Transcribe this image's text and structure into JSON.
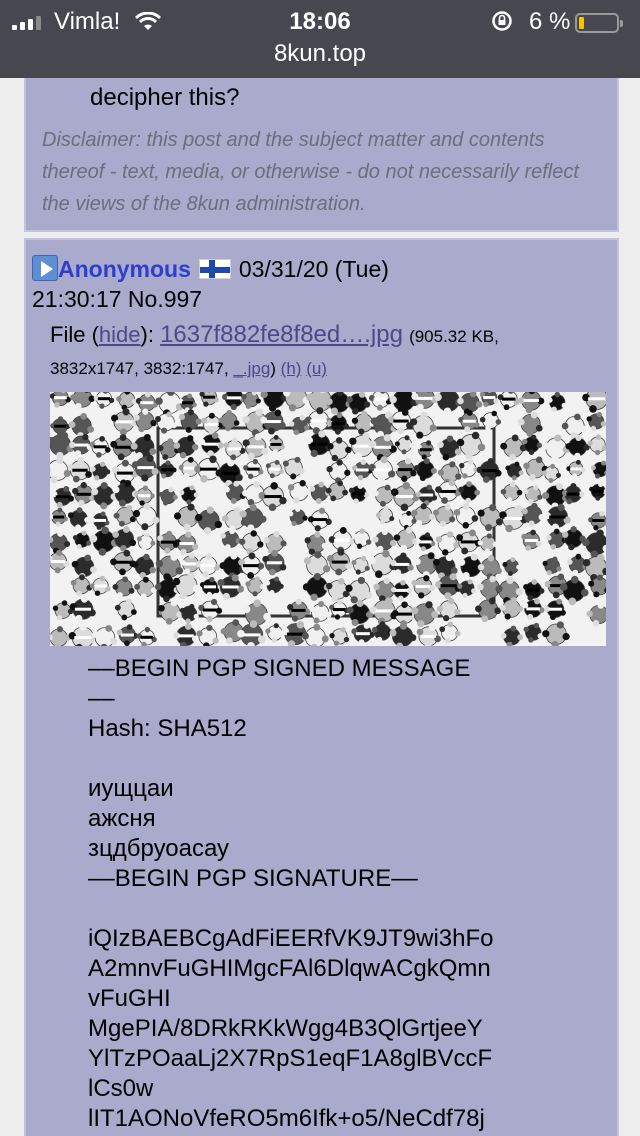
{
  "status": {
    "carrier": "Vimla!",
    "time": "18:06",
    "battery": "6 %",
    "battery_level": 0.06
  },
  "url": "8kun.top",
  "prev_post": {
    "question_tail": "decipher this?",
    "disclaimer": "Disclaimer: this post and the subject matter and contents thereof - text, media, or otherwise - do not necessarily reflect the views of the 8kun administration."
  },
  "post": {
    "name": "Anonymous",
    "date": "03/31/20 (Tue)",
    "time": "21:30:17",
    "number": "No.997",
    "file_label": "File",
    "hide": "hide",
    "filename": "1637f882fe8f8ed….jpg",
    "size": "(905.32 KB,",
    "dims": "3832x1747, 3832:1747,",
    "ext": "_.jpg",
    "h": "(h)",
    "u": "(u)",
    "icons": {
      "expand": "play-icon",
      "flag": "finland-flag-icon"
    },
    "body": [
      "––BEGIN PGP SIGNED MESSAGE",
      "––",
      "Hash: SHA512",
      "",
      "иущцаи",
      "ажсня",
      "зцдбруоасау",
      "––BEGIN PGP SIGNATURE––",
      "",
      "iQIzBAEBCgAdFiEERfVK9JT9wi3hFo",
      "A2mnvFuGHIMgcFAl6DlqwACgkQmn",
      "vFuGHI",
      "MgePIA/8DRkRKkWgg4B3QlGrtjeeY",
      "YlTzPOaaLj2X7RpS1eqF1A8glBVccF",
      "lCs0w",
      "lIT1AONoVfeRO5m6Ifk+o5/NeCdf78j"
    ]
  }
}
